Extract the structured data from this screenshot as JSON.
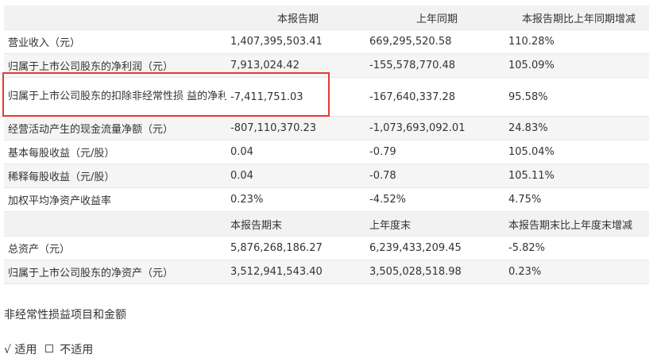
{
  "table": {
    "header1": [
      "",
      "本报告期",
      "上年同期",
      "本报告期比上年同期增减"
    ],
    "rows1": [
      [
        "营业收入（元）",
        "1,407,395,503.41",
        "669,295,520.58",
        "110.28%"
      ],
      [
        "归属于上市公司股东的净利润（元）",
        "7,913,024.42",
        "-155,578,770.48",
        "105.09%"
      ],
      [
        "归属于上市公司股东的扣除非经常性损 益的净利润（元）",
        "-7,411,751.03",
        "-167,640,337.28",
        "95.58%"
      ],
      [
        "经营活动产生的现金流量净额（元）",
        "-807,110,370.23",
        "-1,073,693,092.01",
        "24.83%"
      ],
      [
        "基本每股收益（元/股）",
        "0.04",
        "-0.79",
        "105.04%"
      ],
      [
        "稀释每股收益（元/股）",
        "0.04",
        "-0.78",
        "105.11%"
      ],
      [
        "加权平均净资产收益率",
        "0.23%",
        "-4.52%",
        "4.75%"
      ]
    ],
    "header2": [
      "",
      "本报告期末",
      "上年度末",
      "本报告期末比上年度末增减"
    ],
    "rows2": [
      [
        "总资产（元）",
        "5,876,268,186.27",
        "6,239,433,209.45",
        "-5.82%"
      ],
      [
        "归属于上市公司股东的净资产（元）",
        "3,512,941,543.40",
        "3,505,028,518.98",
        "0.23%"
      ]
    ]
  },
  "section_title": "非经常性损益项目和金额",
  "applicable": {
    "check_mark": "√",
    "applicable_label": "适用",
    "not_applicable_label": "不适用"
  }
}
